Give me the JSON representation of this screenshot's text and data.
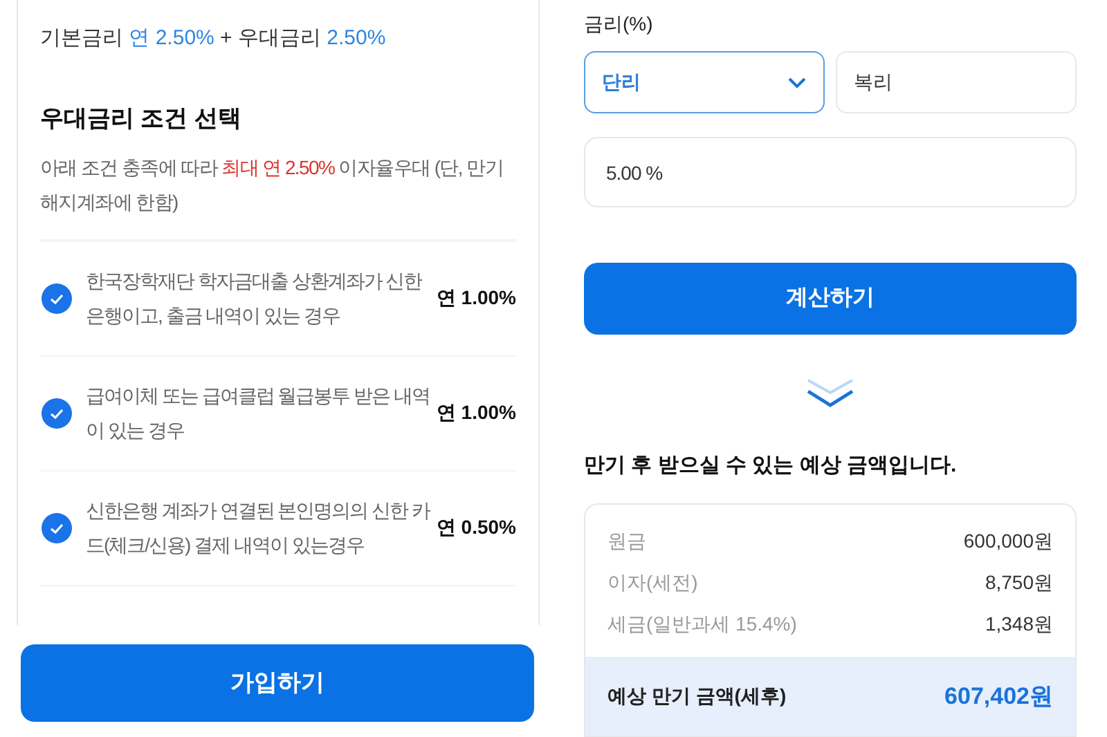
{
  "left": {
    "rate_summary": [
      {
        "text": "기본금리 ",
        "kind": "plain"
      },
      {
        "text": "연 2.50%",
        "kind": "accent"
      },
      {
        "text": " + 우대금리 ",
        "kind": "plain"
      },
      {
        "text": "2.50%",
        "kind": "accent"
      }
    ],
    "section_title": "우대금리 조건 선택",
    "description": [
      {
        "text": "아래 조건 충족에 따라 ",
        "kind": "plain"
      },
      {
        "text": "최대 연 2.50%",
        "kind": "alert"
      },
      {
        "text": " 이자율우대 (단, 만기 해지계좌에 한함)",
        "kind": "plain"
      }
    ],
    "conditions": [
      {
        "text": "한국장학재단 학자금대출 상환계좌가 신한 은행이고, 출금 내역이 있는 경우",
        "rate": "연 1.00%",
        "checked": true
      },
      {
        "text": "급여이체 또는 급여클럽 월급봉투 받은 내역이 있는 경우",
        "rate": "연 1.00%",
        "checked": true
      },
      {
        "text": "신한은행 계좌가 연결된 본인명의의 신한 카드(체크/신용) 결제 내역이 있는경우",
        "rate": "연 0.50%",
        "checked": true
      }
    ],
    "join_button": "가입하기"
  },
  "right": {
    "rate_label": "금리(%)",
    "interest_types": [
      {
        "label": "단리",
        "selected": true
      },
      {
        "label": "복리",
        "selected": false
      }
    ],
    "rate_input": {
      "value": "5.00 %"
    },
    "calculate_button": "계산하기",
    "result_title": "만기 후 받으실 수 있는 예상 금액입니다.",
    "result_rows": [
      {
        "label": "원금",
        "value": "600,000원"
      },
      {
        "label": "이자(세전)",
        "value": "8,750원"
      },
      {
        "label": "세금(일반과세 15.4%)",
        "value": "1,348원"
      }
    ],
    "total": {
      "label": "예상 만기 금액(세후)",
      "value": "607,402원"
    }
  }
}
